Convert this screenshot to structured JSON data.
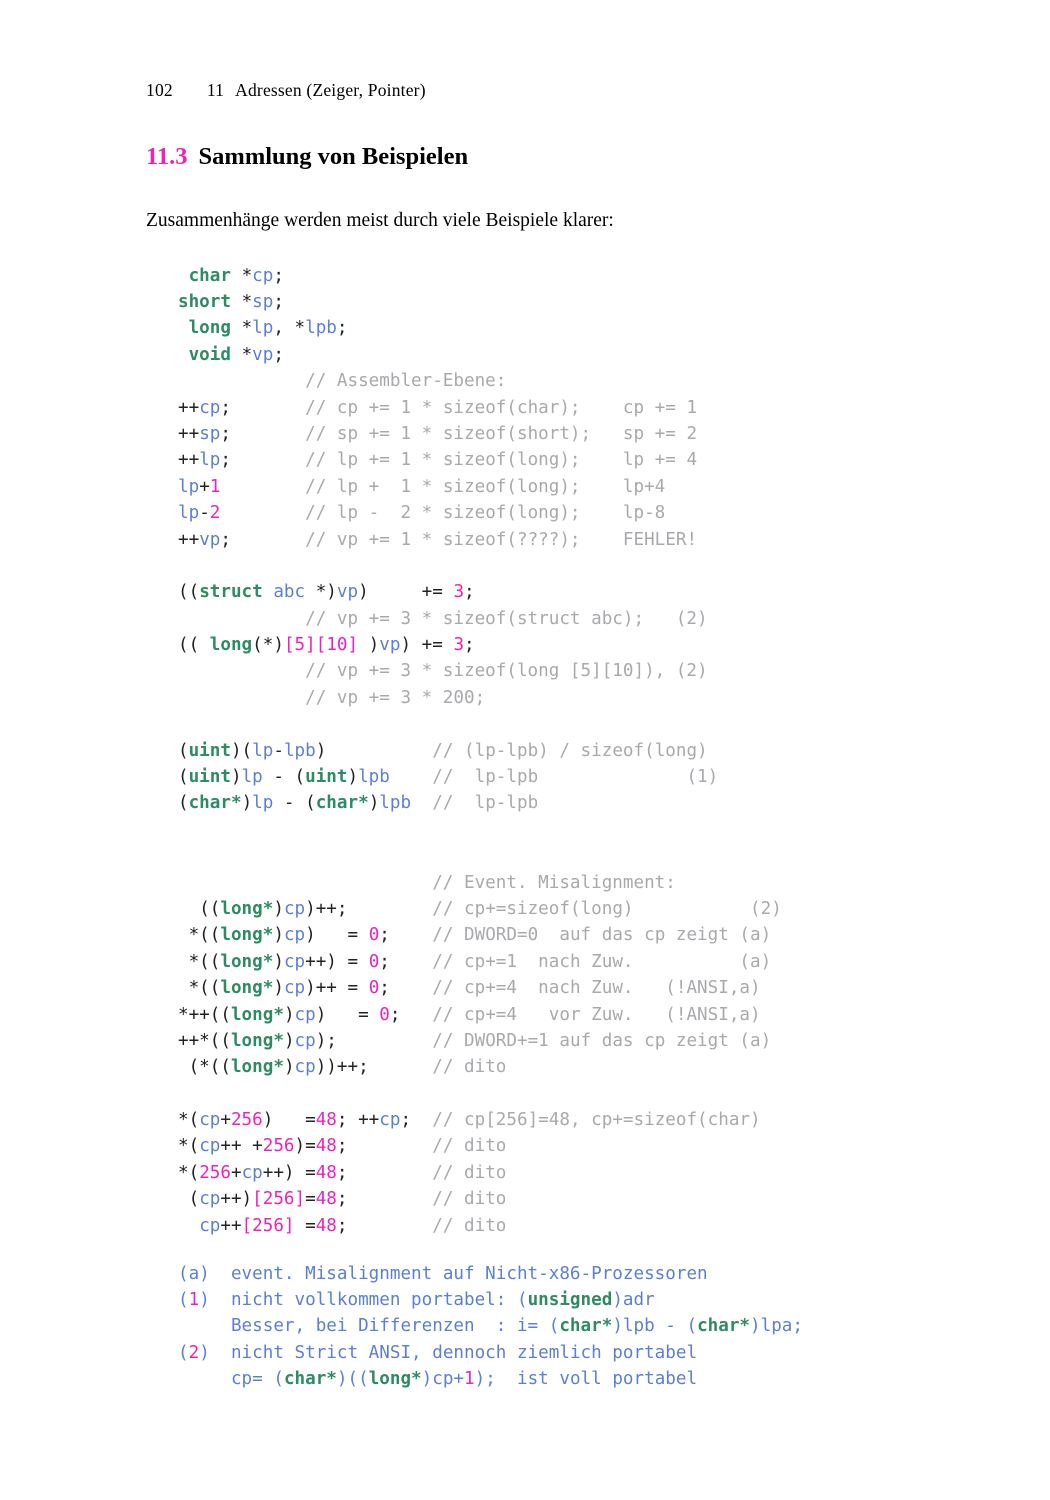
{
  "page": {
    "number": "102",
    "chapter_number": "11",
    "chapter_title": "Adressen (Zeiger, Pointer)"
  },
  "heading": {
    "number": "11.3",
    "title": "Sammlung von Beispielen"
  },
  "intro": {
    "text": "Zusammenhänge werden meist durch viele Beispiele klarer:"
  },
  "code_block": {
    "language": "c",
    "lines": [
      {
        "id": "decl-char",
        "text": " char *cp;"
      },
      {
        "id": "decl-short",
        "text": "short *sp;"
      },
      {
        "id": "decl-long",
        "text": " long *lp, *lpb;"
      },
      {
        "id": "decl-void",
        "text": " void *vp;"
      },
      {
        "id": "cmt-asm",
        "text": "            // Assembler-Ebene:"
      },
      {
        "id": "inc-cp",
        "text": "++cp;       // cp += 1 * sizeof(char);    cp += 1"
      },
      {
        "id": "inc-sp",
        "text": "++sp;       // sp += 1 * sizeof(short);   sp += 2"
      },
      {
        "id": "inc-lp",
        "text": "++lp;       // lp += 1 * sizeof(long);    lp += 4"
      },
      {
        "id": "lp-plus-1",
        "text": "lp+1        // lp +  1 * sizeof(long);    lp+4"
      },
      {
        "id": "lp-minus-2",
        "text": "lp-2        // lp -  2 * sizeof(long);    lp-8"
      },
      {
        "id": "inc-vp",
        "text": "++vp;       // vp += 1 * sizeof(????);    FEHLER!"
      },
      {
        "id": "blank-1",
        "text": ""
      },
      {
        "id": "struct-cast",
        "text": "((struct abc *)vp)     += 3;"
      },
      {
        "id": "cmt-struct",
        "text": "            // vp += 3 * sizeof(struct abc);   (2)"
      },
      {
        "id": "array-cast",
        "text": "(( long(*)[5][10] )vp) += 3;"
      },
      {
        "id": "cmt-array",
        "text": "            // vp += 3 * sizeof(long [5][10]), (2)"
      },
      {
        "id": "cmt-array2",
        "text": "            // vp += 3 * 200;"
      },
      {
        "id": "blank-2",
        "text": ""
      },
      {
        "id": "uint-diff",
        "text": "(uint)(lp-lpb)          // (lp-lpb) / sizeof(long)"
      },
      {
        "id": "uint-sub",
        "text": "(uint)lp - (uint)lpb    //  lp-lpb              (1)"
      },
      {
        "id": "char-sub",
        "text": "(char*)lp - (char*)lpb  //  lp-lpb"
      },
      {
        "id": "blank-3",
        "text": ""
      },
      {
        "id": "blank-4",
        "text": ""
      },
      {
        "id": "cmt-misal",
        "text": "                        // Event. Misalignment:"
      },
      {
        "id": "long-inc",
        "text": "  ((long*)cp)++;        // cp+=sizeof(long)           (2)"
      },
      {
        "id": "long-set0",
        "text": " *((long*)cp)   = 0;    // DWORD=0  auf das cp zeigt (a)"
      },
      {
        "id": "long-post",
        "text": " *((long*)cp++) = 0;    // cp+=1  nach Zuw.          (a)"
      },
      {
        "id": "long-post2",
        "text": " *((long*)cp)++ = 0;    // cp+=4  nach Zuw.   (!ANSI,a)"
      },
      {
        "id": "long-pre",
        "text": "*++((long*)cp)   = 0;   // cp+=4   vor Zuw.   (!ANSI,a)"
      },
      {
        "id": "long-deref",
        "text": "++*((long*)cp);         // DWORD+=1 auf das cp zeigt (a)"
      },
      {
        "id": "long-dito",
        "text": " (*((long*)cp))++;      // dito"
      },
      {
        "id": "blank-5",
        "text": ""
      },
      {
        "id": "cp256-a",
        "text": "*(cp+256)   =48; ++cp;  // cp[256]=48, cp+=sizeof(char)"
      },
      {
        "id": "cp256-b",
        "text": "*(cp++ +256)=48;        // dito"
      },
      {
        "id": "cp256-c",
        "text": "*(256+cp++) =48;        // dito"
      },
      {
        "id": "cp256-d",
        "text": " (cp++)[256]=48;        // dito"
      },
      {
        "id": "cp256-e",
        "text": "  cp++[256] =48;        // dito"
      }
    ]
  },
  "footnotes": {
    "lines": [
      {
        "id": "note-a",
        "text": "(a)  event. Misalignment auf Nicht-x86-Prozessoren"
      },
      {
        "id": "note-1",
        "text": "(1)  nicht vollkommen portabel: (unsigned)adr"
      },
      {
        "id": "note-1b",
        "text": "     Besser, bei Differenzen  : i= (char*)lpb - (char*)lpa;"
      },
      {
        "id": "note-2",
        "text": "(2)  nicht Strict ANSI, dennoch ziemlich portabel"
      },
      {
        "id": "note-2b",
        "text": "     cp= (char*)((long*)cp+1);  ist voll portabel"
      }
    ]
  },
  "colors": {
    "keyword": "#2e8b62",
    "identifier": "#5b7fd4",
    "number": "#ee22bb",
    "comment": "#a9a9ad",
    "plain": "#222222",
    "text": "#000000",
    "background": "#ffffff"
  }
}
